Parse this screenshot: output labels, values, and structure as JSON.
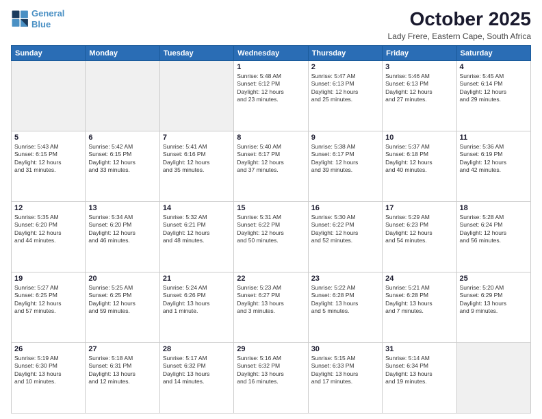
{
  "header": {
    "logo_line1": "General",
    "logo_line2": "Blue",
    "month": "October 2025",
    "location": "Lady Frere, Eastern Cape, South Africa"
  },
  "days_of_week": [
    "Sunday",
    "Monday",
    "Tuesday",
    "Wednesday",
    "Thursday",
    "Friday",
    "Saturday"
  ],
  "weeks": [
    [
      {
        "day": "",
        "info": ""
      },
      {
        "day": "",
        "info": ""
      },
      {
        "day": "",
        "info": ""
      },
      {
        "day": "1",
        "info": "Sunrise: 5:48 AM\nSunset: 6:12 PM\nDaylight: 12 hours\nand 23 minutes."
      },
      {
        "day": "2",
        "info": "Sunrise: 5:47 AM\nSunset: 6:13 PM\nDaylight: 12 hours\nand 25 minutes."
      },
      {
        "day": "3",
        "info": "Sunrise: 5:46 AM\nSunset: 6:13 PM\nDaylight: 12 hours\nand 27 minutes."
      },
      {
        "day": "4",
        "info": "Sunrise: 5:45 AM\nSunset: 6:14 PM\nDaylight: 12 hours\nand 29 minutes."
      }
    ],
    [
      {
        "day": "5",
        "info": "Sunrise: 5:43 AM\nSunset: 6:15 PM\nDaylight: 12 hours\nand 31 minutes."
      },
      {
        "day": "6",
        "info": "Sunrise: 5:42 AM\nSunset: 6:15 PM\nDaylight: 12 hours\nand 33 minutes."
      },
      {
        "day": "7",
        "info": "Sunrise: 5:41 AM\nSunset: 6:16 PM\nDaylight: 12 hours\nand 35 minutes."
      },
      {
        "day": "8",
        "info": "Sunrise: 5:40 AM\nSunset: 6:17 PM\nDaylight: 12 hours\nand 37 minutes."
      },
      {
        "day": "9",
        "info": "Sunrise: 5:38 AM\nSunset: 6:17 PM\nDaylight: 12 hours\nand 39 minutes."
      },
      {
        "day": "10",
        "info": "Sunrise: 5:37 AM\nSunset: 6:18 PM\nDaylight: 12 hours\nand 40 minutes."
      },
      {
        "day": "11",
        "info": "Sunrise: 5:36 AM\nSunset: 6:19 PM\nDaylight: 12 hours\nand 42 minutes."
      }
    ],
    [
      {
        "day": "12",
        "info": "Sunrise: 5:35 AM\nSunset: 6:20 PM\nDaylight: 12 hours\nand 44 minutes."
      },
      {
        "day": "13",
        "info": "Sunrise: 5:34 AM\nSunset: 6:20 PM\nDaylight: 12 hours\nand 46 minutes."
      },
      {
        "day": "14",
        "info": "Sunrise: 5:32 AM\nSunset: 6:21 PM\nDaylight: 12 hours\nand 48 minutes."
      },
      {
        "day": "15",
        "info": "Sunrise: 5:31 AM\nSunset: 6:22 PM\nDaylight: 12 hours\nand 50 minutes."
      },
      {
        "day": "16",
        "info": "Sunrise: 5:30 AM\nSunset: 6:22 PM\nDaylight: 12 hours\nand 52 minutes."
      },
      {
        "day": "17",
        "info": "Sunrise: 5:29 AM\nSunset: 6:23 PM\nDaylight: 12 hours\nand 54 minutes."
      },
      {
        "day": "18",
        "info": "Sunrise: 5:28 AM\nSunset: 6:24 PM\nDaylight: 12 hours\nand 56 minutes."
      }
    ],
    [
      {
        "day": "19",
        "info": "Sunrise: 5:27 AM\nSunset: 6:25 PM\nDaylight: 12 hours\nand 57 minutes."
      },
      {
        "day": "20",
        "info": "Sunrise: 5:25 AM\nSunset: 6:25 PM\nDaylight: 12 hours\nand 59 minutes."
      },
      {
        "day": "21",
        "info": "Sunrise: 5:24 AM\nSunset: 6:26 PM\nDaylight: 13 hours\nand 1 minute."
      },
      {
        "day": "22",
        "info": "Sunrise: 5:23 AM\nSunset: 6:27 PM\nDaylight: 13 hours\nand 3 minutes."
      },
      {
        "day": "23",
        "info": "Sunrise: 5:22 AM\nSunset: 6:28 PM\nDaylight: 13 hours\nand 5 minutes."
      },
      {
        "day": "24",
        "info": "Sunrise: 5:21 AM\nSunset: 6:28 PM\nDaylight: 13 hours\nand 7 minutes."
      },
      {
        "day": "25",
        "info": "Sunrise: 5:20 AM\nSunset: 6:29 PM\nDaylight: 13 hours\nand 9 minutes."
      }
    ],
    [
      {
        "day": "26",
        "info": "Sunrise: 5:19 AM\nSunset: 6:30 PM\nDaylight: 13 hours\nand 10 minutes."
      },
      {
        "day": "27",
        "info": "Sunrise: 5:18 AM\nSunset: 6:31 PM\nDaylight: 13 hours\nand 12 minutes."
      },
      {
        "day": "28",
        "info": "Sunrise: 5:17 AM\nSunset: 6:32 PM\nDaylight: 13 hours\nand 14 minutes."
      },
      {
        "day": "29",
        "info": "Sunrise: 5:16 AM\nSunset: 6:32 PM\nDaylight: 13 hours\nand 16 minutes."
      },
      {
        "day": "30",
        "info": "Sunrise: 5:15 AM\nSunset: 6:33 PM\nDaylight: 13 hours\nand 17 minutes."
      },
      {
        "day": "31",
        "info": "Sunrise: 5:14 AM\nSunset: 6:34 PM\nDaylight: 13 hours\nand 19 minutes."
      },
      {
        "day": "",
        "info": ""
      }
    ]
  ]
}
